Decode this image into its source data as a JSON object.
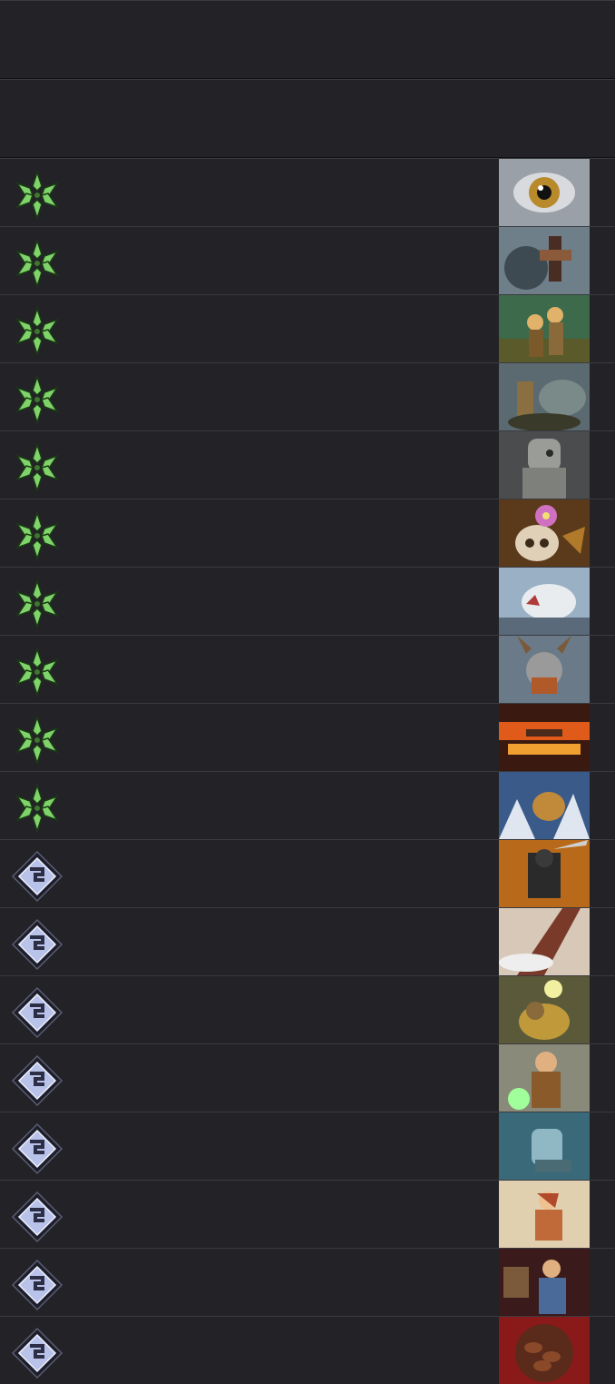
{
  "header_rows": [
    {
      "label": ""
    },
    {
      "label": ""
    }
  ],
  "colors": {
    "background": "#1f1f23",
    "row_bg": "#232327",
    "row_divider": "#3a3a3f",
    "nature_icon": "#7fd36a",
    "arcane_icon": "#b9c2e8"
  },
  "rows": [
    {
      "type_icon": "green-leaf-icon",
      "thumb": "owl-eye",
      "label": ""
    },
    {
      "type_icon": "green-leaf-icon",
      "thumb": "chain-saw-rider",
      "label": ""
    },
    {
      "type_icon": "green-leaf-icon",
      "thumb": "forest-archers",
      "label": ""
    },
    {
      "type_icon": "green-leaf-icon",
      "thumb": "beast-riders",
      "label": ""
    },
    {
      "type_icon": "green-leaf-icon",
      "thumb": "stone-golem",
      "label": ""
    },
    {
      "type_icon": "green-leaf-icon",
      "thumb": "skull-flower",
      "label": ""
    },
    {
      "type_icon": "green-leaf-icon",
      "thumb": "snow-wolf",
      "label": ""
    },
    {
      "type_icon": "green-leaf-icon",
      "thumb": "horned-warrior",
      "label": ""
    },
    {
      "type_icon": "green-leaf-icon",
      "thumb": "lava-field",
      "label": ""
    },
    {
      "type_icon": "green-leaf-icon",
      "thumb": "winter-lynx",
      "label": ""
    },
    {
      "type_icon": "silver-diamond-icon",
      "thumb": "dark-rogue",
      "label": ""
    },
    {
      "type_icon": "silver-diamond-icon",
      "thumb": "wind-storm",
      "label": ""
    },
    {
      "type_icon": "silver-diamond-icon",
      "thumb": "golden-knight",
      "label": ""
    },
    {
      "type_icon": "silver-diamond-icon",
      "thumb": "dwarf-caster",
      "label": ""
    },
    {
      "type_icon": "silver-diamond-icon",
      "thumb": "ice-statue",
      "label": ""
    },
    {
      "type_icon": "silver-diamond-icon",
      "thumb": "red-hair-fighter",
      "label": ""
    },
    {
      "type_icon": "silver-diamond-icon",
      "thumb": "blue-scholar",
      "label": ""
    },
    {
      "type_icon": "silver-diamond-icon",
      "thumb": "cocoa-beans",
      "label": ""
    }
  ]
}
